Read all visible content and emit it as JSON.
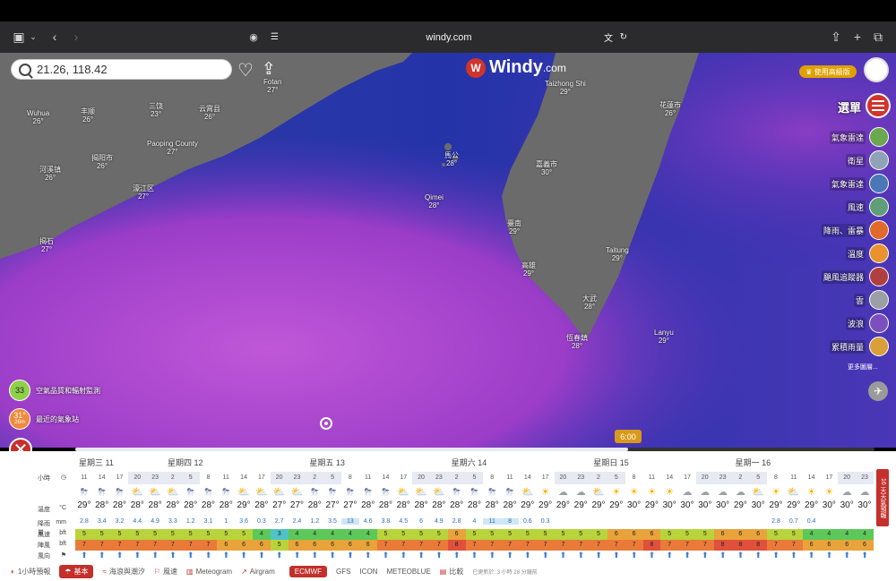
{
  "browser": {
    "url": "windy.com"
  },
  "search": {
    "value": "21.26, 118.42"
  },
  "brand": {
    "name": "Windy",
    "suffix": ".com"
  },
  "premium_label": "♛ 使用高級版",
  "menu_label": "選單",
  "layers": [
    {
      "label": "氣象雷達",
      "color": "#6aa84f"
    },
    {
      "label": "衛星",
      "color": "#8fa3b8"
    },
    {
      "label": "氣象雷達",
      "color": "#4a77b5"
    },
    {
      "label": "風速",
      "color": "#5f9e78"
    },
    {
      "label": "降雨、雷暴",
      "color": "#e06a2b"
    },
    {
      "label": "溫度",
      "color": "#e8932e"
    },
    {
      "label": "颶風追蹤器",
      "color": "#b04040"
    },
    {
      "label": "雲",
      "color": "#9aa0a6"
    },
    {
      "label": "波浪",
      "color": "#7b4fbf"
    },
    {
      "label": "累積雨量",
      "color": "#d9a03a"
    }
  ],
  "more_layers": "更多圖層...",
  "air_quality": {
    "value": "33",
    "label": "空氣品質和輻射監測"
  },
  "station": {
    "value": "31°",
    "sub": "26m",
    "label": "最近的氣象站"
  },
  "time_bubble": "6:00",
  "places": [
    {
      "name": "Wuhua",
      "temp": "26°"
    },
    {
      "name": "丰顺",
      "temp": "26°"
    },
    {
      "name": "三饶",
      "temp": "23°"
    },
    {
      "name": "云霄县",
      "temp": "26°"
    },
    {
      "name": "Paoping County",
      "temp": "27°"
    },
    {
      "name": "揭阳市",
      "temp": "26°"
    },
    {
      "name": "河溪镇",
      "temp": "26°"
    },
    {
      "name": "濠江区",
      "temp": "27°"
    },
    {
      "name": "揭石",
      "temp": "27°"
    },
    {
      "name": "Fotan",
      "temp": "27°"
    },
    {
      "name": "Taizhong Shi",
      "temp": "29°"
    },
    {
      "name": "馬公",
      "temp": "28°"
    },
    {
      "name": "Qimei",
      "temp": "28°"
    },
    {
      "name": "嘉義市",
      "temp": "30°"
    },
    {
      "name": "臺南",
      "temp": "29°"
    },
    {
      "name": "高雄",
      "temp": "29°"
    },
    {
      "name": "恆春鎮",
      "temp": "28°"
    },
    {
      "name": "花蓮市",
      "temp": "26°"
    },
    {
      "name": "Taitung",
      "temp": "29°"
    },
    {
      "name": "Lanyu",
      "temp": "29°"
    },
    {
      "name": "大武",
      "temp": "28°"
    }
  ],
  "forecast": {
    "days": [
      "星期三 11",
      "星期四 12",
      "星期五 13",
      "星期六 14",
      "星期日 15",
      "星期一 16"
    ],
    "row_labels": {
      "hours": "小時",
      "temp": "溫度",
      "temp_unit": "°C",
      "rain": "降雨量",
      "rain_unit": "mm",
      "wind": "風速",
      "wind_unit": "bft",
      "gust": "陣風",
      "gust_unit": "bft",
      "dir": "風向"
    },
    "hours": [
      "11",
      "14",
      "17",
      "20",
      "23",
      "2",
      "5",
      "8",
      "11",
      "14",
      "17",
      "20",
      "23",
      "2",
      "5",
      "8",
      "11",
      "14",
      "17",
      "20",
      "23",
      "2",
      "5",
      "8",
      "11",
      "14",
      "17",
      "20",
      "23",
      "2",
      "5",
      "8",
      "11",
      "14",
      "17",
      "20",
      "23",
      "2",
      "5",
      "8",
      "11",
      "14",
      "17",
      "20",
      "23"
    ],
    "icons": [
      "⛈",
      "⛈",
      "⛈",
      "⛅",
      "⛅",
      "⛅",
      "⛈",
      "⛈",
      "⛈",
      "⛅",
      "⛅",
      "⛅",
      "⛅",
      "⛈",
      "⛈",
      "⛈",
      "⛈",
      "⛈",
      "⛅",
      "⛅",
      "⛅",
      "⛈",
      "⛈",
      "⛈",
      "⛈",
      "⛅",
      "☀",
      "☁",
      "☁",
      "⛅",
      "☀",
      "☀",
      "☀",
      "☀",
      "☁",
      "☁",
      "☁",
      "☁",
      "⛅",
      "☀",
      "⛅",
      "☀",
      "☀",
      "☁",
      "☁"
    ],
    "temps": [
      "29°",
      "28°",
      "28°",
      "28°",
      "28°",
      "28°",
      "28°",
      "28°",
      "28°",
      "29°",
      "28°",
      "27°",
      "27°",
      "28°",
      "27°",
      "27°",
      "28°",
      "28°",
      "28°",
      "28°",
      "28°",
      "28°",
      "28°",
      "28°",
      "28°",
      "29°",
      "29°",
      "29°",
      "29°",
      "29°",
      "29°",
      "30°",
      "29°",
      "30°",
      "30°",
      "30°",
      "30°",
      "29°",
      "30°",
      "29°",
      "29°",
      "29°",
      "30°",
      "30°",
      "30°"
    ],
    "rain": [
      "2.8",
      "3.4",
      "3.2",
      "4.4",
      "4.9",
      "3.3",
      "1.2",
      "3.1",
      "1",
      "3.6",
      "0.3",
      "2.7",
      "2.4",
      "1.2",
      "3.5",
      "13",
      "4.6",
      "3.8",
      "4.5",
      "6",
      "4.9",
      "2.8",
      "4",
      "11",
      "8",
      "0.6",
      "0.3",
      "",
      "",
      "",
      "",
      "",
      "",
      "",
      "",
      "",
      "",
      "",
      "",
      "2.8",
      "0.7",
      "0.4",
      "",
      "",
      ""
    ],
    "wind": [
      "5",
      "5",
      "5",
      "5",
      "5",
      "5",
      "5",
      "5",
      "5",
      "5",
      "4",
      "3",
      "4",
      "4",
      "4",
      "4",
      "4",
      "5",
      "5",
      "5",
      "5",
      "6",
      "5",
      "5",
      "5",
      "5",
      "5",
      "5",
      "5",
      "5",
      "6",
      "6",
      "6",
      "5",
      "5",
      "5",
      "6",
      "6",
      "6",
      "5",
      "5",
      "4",
      "4",
      "4",
      "4"
    ],
    "gust": [
      "7",
      "7",
      "7",
      "7",
      "7",
      "7",
      "7",
      "7",
      "6",
      "6",
      "6",
      "5",
      "6",
      "6",
      "6",
      "6",
      "6",
      "7",
      "7",
      "7",
      "7",
      "8",
      "7",
      "7",
      "7",
      "7",
      "7",
      "7",
      "7",
      "7",
      "7",
      "7",
      "8",
      "7",
      "7",
      "7",
      "8",
      "8",
      "8",
      "7",
      "7",
      "6",
      "6",
      "6",
      "6"
    ]
  },
  "side_tab": "16 天天氣預報",
  "bottom": {
    "forecast_mode": "1小時預報",
    "tabs": [
      "基本",
      "海浪與潮汐",
      "風速",
      "Meteogram",
      "Airgram"
    ],
    "models": [
      "ECMWF",
      "GFS",
      "ICON",
      "METEOBLUE",
      "比較"
    ],
    "updated": "已更新於: 3 小時 28 分鐘前"
  }
}
